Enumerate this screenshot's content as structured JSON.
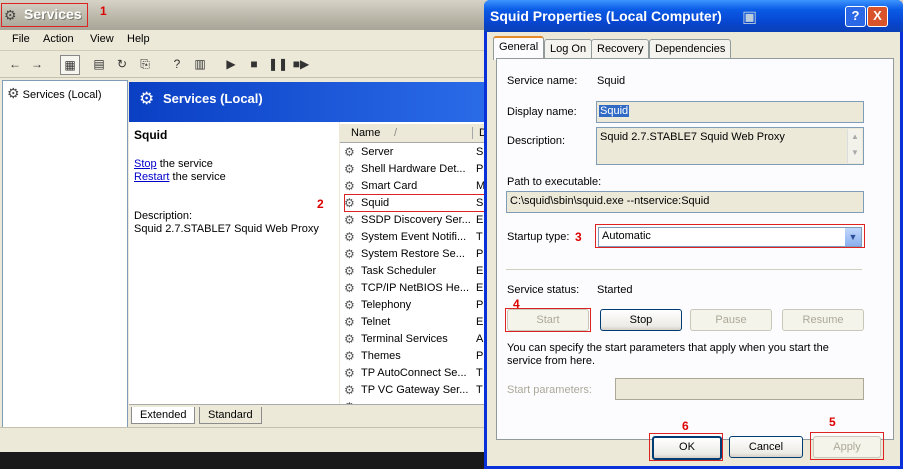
{
  "services_window": {
    "title": "Services",
    "menu": [
      "File",
      "Action",
      "View",
      "Help"
    ],
    "tree_root": "Services (Local)",
    "header": "Services (Local)",
    "selected_service": "Squid",
    "stop_link": "Stop",
    "stop_rest": " the service",
    "restart_link": "Restart",
    "restart_rest": " the service",
    "description_label": "Description:",
    "description_text": "Squid 2.7.STABLE7 Squid Web Proxy",
    "list_header_name": "Name",
    "list_header_sort": "/",
    "list_header_desc": "D",
    "services": [
      {
        "name": "Server",
        "desc": "S"
      },
      {
        "name": "Shell Hardware Det...",
        "desc": "P"
      },
      {
        "name": "Smart Card",
        "desc": "M"
      },
      {
        "name": "Squid",
        "desc": "S"
      },
      {
        "name": "SSDP Discovery Ser...",
        "desc": "E"
      },
      {
        "name": "System Event Notifi...",
        "desc": "T"
      },
      {
        "name": "System Restore Se...",
        "desc": "P"
      },
      {
        "name": "Task Scheduler",
        "desc": "E"
      },
      {
        "name": "TCP/IP NetBIOS He...",
        "desc": "E"
      },
      {
        "name": "Telephony",
        "desc": "P"
      },
      {
        "name": "Telnet",
        "desc": "E"
      },
      {
        "name": "Terminal Services",
        "desc": "A"
      },
      {
        "name": "Themes",
        "desc": "P"
      },
      {
        "name": "TP AutoConnect Se...",
        "desc": "T"
      },
      {
        "name": "TP VC Gateway Ser...",
        "desc": "T"
      },
      {
        "name": "",
        "desc": ""
      }
    ],
    "tab_extended": "Extended",
    "tab_standard": "Standard"
  },
  "dialog": {
    "title": "Squid Properties (Local Computer)",
    "help_btn": "?",
    "close_btn": "X",
    "tabs": [
      "General",
      "Log On",
      "Recovery",
      "Dependencies"
    ],
    "service_name_label": "Service name:",
    "service_name": "Squid",
    "display_name_label": "Display name:",
    "display_name": "Squid",
    "description_label": "Description:",
    "description": "Squid 2.7.STABLE7 Squid Web Proxy",
    "path_label": "Path to executable:",
    "path": "C:\\squid\\sbin\\squid.exe --ntservice:Squid",
    "startup_label": "Startup type:",
    "startup_value": "Automatic",
    "status_label": "Service status:",
    "status_value": "Started",
    "btn_start": "Start",
    "btn_stop": "Stop",
    "btn_pause": "Pause",
    "btn_resume": "Resume",
    "params_note": "You can specify the start parameters that apply when you start the service from here.",
    "params_label": "Start parameters:",
    "btn_ok": "OK",
    "btn_cancel": "Cancel",
    "btn_apply": "Apply"
  },
  "annotations": [
    "1",
    "2",
    "3",
    "4",
    "5",
    "6"
  ],
  "colors": {
    "accent_blue": "#0054e3",
    "callout_red": "#dd2222",
    "titlebar_blue": "#0a5be6"
  }
}
